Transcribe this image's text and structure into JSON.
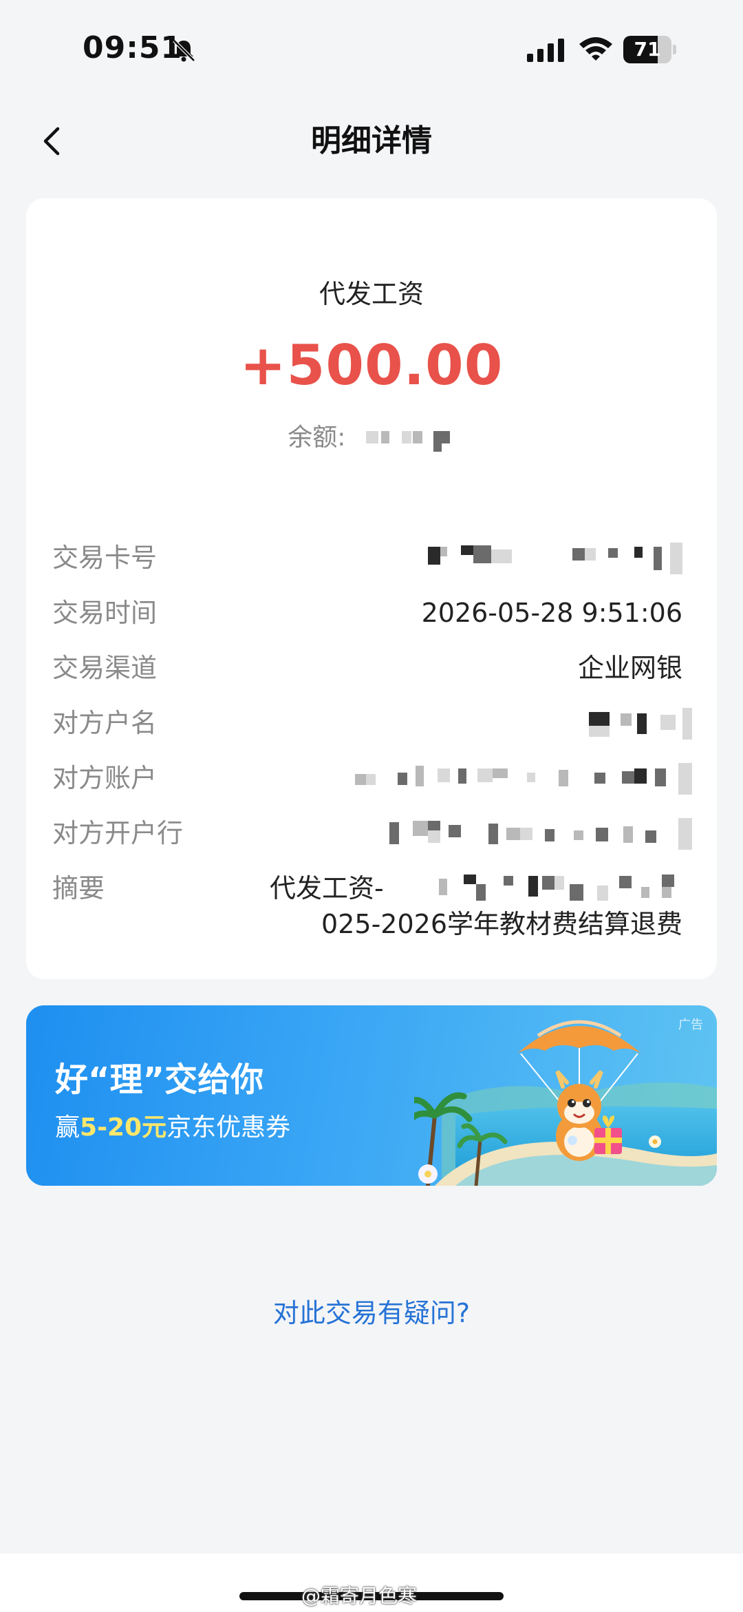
{
  "status_bar": {
    "time": "09:51",
    "battery": "71",
    "battery_level": 0.71,
    "icons": [
      "bell-slash-icon",
      "cellular-signal-icon",
      "wifi-icon",
      "battery-icon"
    ]
  },
  "header": {
    "title": "明细详情",
    "back_icon": "chevron-left-icon"
  },
  "transaction": {
    "type": "代发工资",
    "amount": "+500.00",
    "balance_label": "余额:",
    "amount_color": "#e8524a"
  },
  "details": [
    {
      "label": "交易卡号",
      "value": ""
    },
    {
      "label": "交易时间",
      "value": "2026-05-28 9:51:06"
    },
    {
      "label": "交易渠道",
      "value": "企业网银"
    },
    {
      "label": "对方户名",
      "value": ""
    },
    {
      "label": "对方账户",
      "value": ""
    },
    {
      "label": "对方开户行",
      "value": ""
    }
  ],
  "summary": {
    "label": "摘要",
    "line1_prefix": "代发工资-",
    "line2": "025-2026学年教材费结算退费"
  },
  "ad": {
    "tag": "广告",
    "title": "好“理”交给你",
    "subtitle_prefix": "赢",
    "subtitle_highlight": "5-20元",
    "subtitle_suffix": "京东优惠券"
  },
  "question_link": "对此交易有疑问?",
  "watermark": "@霜寄月色寒",
  "colors": {
    "background": "#f4f5f7",
    "link": "#2673d6",
    "label": "#8a8a8a"
  }
}
